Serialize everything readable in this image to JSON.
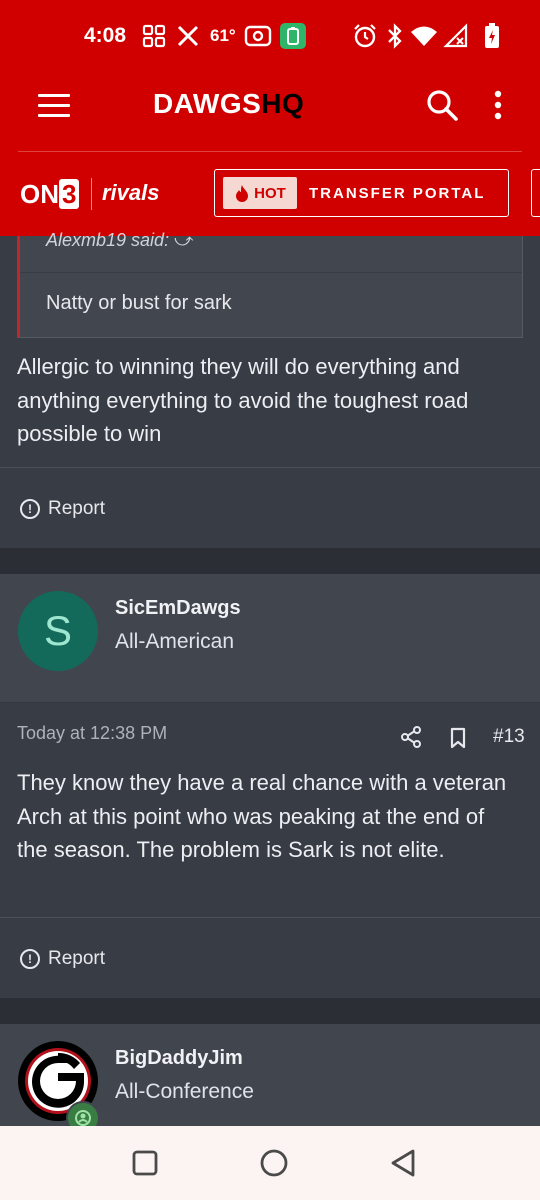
{
  "status": {
    "time": "4:08",
    "temperature": "61°",
    "icons": [
      "grid-icon",
      "x-icon",
      "radio-icon",
      "battery-app-icon",
      "alarm-icon",
      "bluetooth-icon",
      "wifi-icon",
      "signal-icon",
      "battery-icon"
    ]
  },
  "app": {
    "logo_main": "DAWGS",
    "logo_hq": "HQ",
    "brand_on3": "ON",
    "brand_on3_num": "3",
    "brand_rivals": "rivals",
    "hot_label": "HOT",
    "transfer_label": "TRANSFER PORTAL"
  },
  "thread": {
    "quote": {
      "attribution": "Alexmb19 said:",
      "text": "Natty or bust for sark"
    },
    "post1": {
      "text": "Allergic to winning they will do everything and anything everything to avoid the toughest road possible to win",
      "report_label": "Report"
    },
    "post2": {
      "avatar_letter": "S",
      "username": "SicEmDawgs",
      "rank": "All-American",
      "timestamp": "Today at 12:38 PM",
      "post_number": "#13",
      "text": "They know they have a real chance with a veteran Arch at this point who was peaking at the end of the season. The problem is Sark is not elite.",
      "report_label": "Report"
    },
    "post3": {
      "username": "BigDaddyJim",
      "rank": "All-Conference"
    }
  },
  "colors": {
    "brand_red": "#d10000",
    "background": "#383c45",
    "card": "#41454e",
    "avatar_teal": "#136a5b"
  }
}
